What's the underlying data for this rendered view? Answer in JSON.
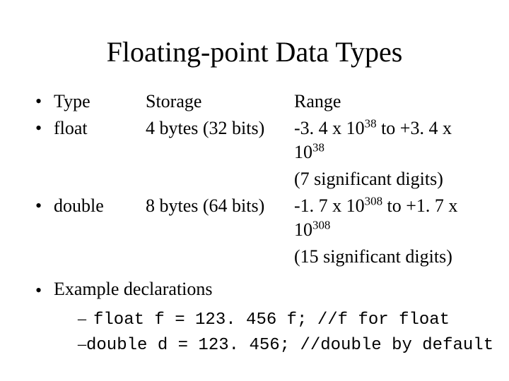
{
  "title": "Floating-point Data Types",
  "header": {
    "type": "Type",
    "storage": "Storage",
    "range": "Range"
  },
  "rows": [
    {
      "type": "float",
      "storage": "4 bytes (32 bits)",
      "range_a": "-3. 4 x 10",
      "range_b": " to +3. 4 x 10",
      "exp": "38",
      "precision": "(7 significant digits)"
    },
    {
      "type": "double",
      "storage": "8 bytes (64 bits)",
      "range_a": "-1. 7 x 10",
      "range_b": " to +1. 7 x 10",
      "exp": "308",
      "precision": "(15 significant digits)"
    }
  ],
  "example_label": "Example declarations",
  "code": [
    "float f = 123. 456 f; //f for float",
    "double d = 123. 456; //double by default"
  ],
  "bullet": "•",
  "dash": "–"
}
